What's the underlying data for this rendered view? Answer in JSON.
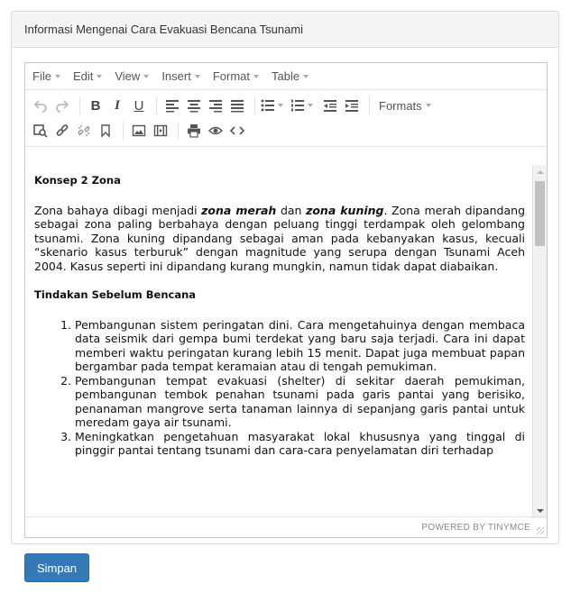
{
  "panel": {
    "title": "Informasi Mengenai Cara Evakuasi Bencana Tsunami"
  },
  "menubar": [
    "File",
    "Edit",
    "View",
    "Insert",
    "Format",
    "Table"
  ],
  "toolbar": {
    "formats_label": "Formats"
  },
  "content": {
    "heading1": "Konsep 2 Zona",
    "para_start": "Zona bahaya dibagi menjadi ",
    "zona_merah": "zona merah",
    "para_mid": " dan ",
    "zona_kuning": "zona kuning",
    "para_end": ". Zona merah dipandang sebagai zona paling berbahaya dengan peluang tinggi terdampak oleh gelombang tsunami. Zona kuning dipandang sebagai aman pada kebanyakan kasus, kecuali “skenario kasus terburuk” dengan magnitude yang serupa dengan Tsunami Aceh 2004. Kasus seperti ini dipandang kurang mungkin, namun tidak dapat diabaikan.",
    "heading2": "Tindakan Sebelum Bencana",
    "list": [
      "Pembangunan sistem peringatan dini. Cara mengetahuinya dengan membaca data seismik dari gempa bumi terdekat yang baru saja terjadi. Cara ini dapat memberi waktu peringatan kurang lebih 15 menit. Dapat juga membuat papan bergambar pada tempat keramaian atau di tengah pemukiman.",
      "Pembangunan tempat evakuasi (shelter) di sekitar daerah pemukiman, pembangunan tembok penahan tsunami pada garis pantai yang berisiko, penanaman mangrove serta tanaman lainnya di sepanjang garis pantai untuk meredam gaya air tsunami.",
      "Meningkatkan pengetahuan masyarakat lokal khususnya yang tinggal di pinggir pantai tentang tsunami dan cara-cara penyelamatan diri terhadap"
    ]
  },
  "statusbar": {
    "powered_by": "POWERED BY TINYMCE"
  },
  "buttons": {
    "save": "Simpan"
  }
}
